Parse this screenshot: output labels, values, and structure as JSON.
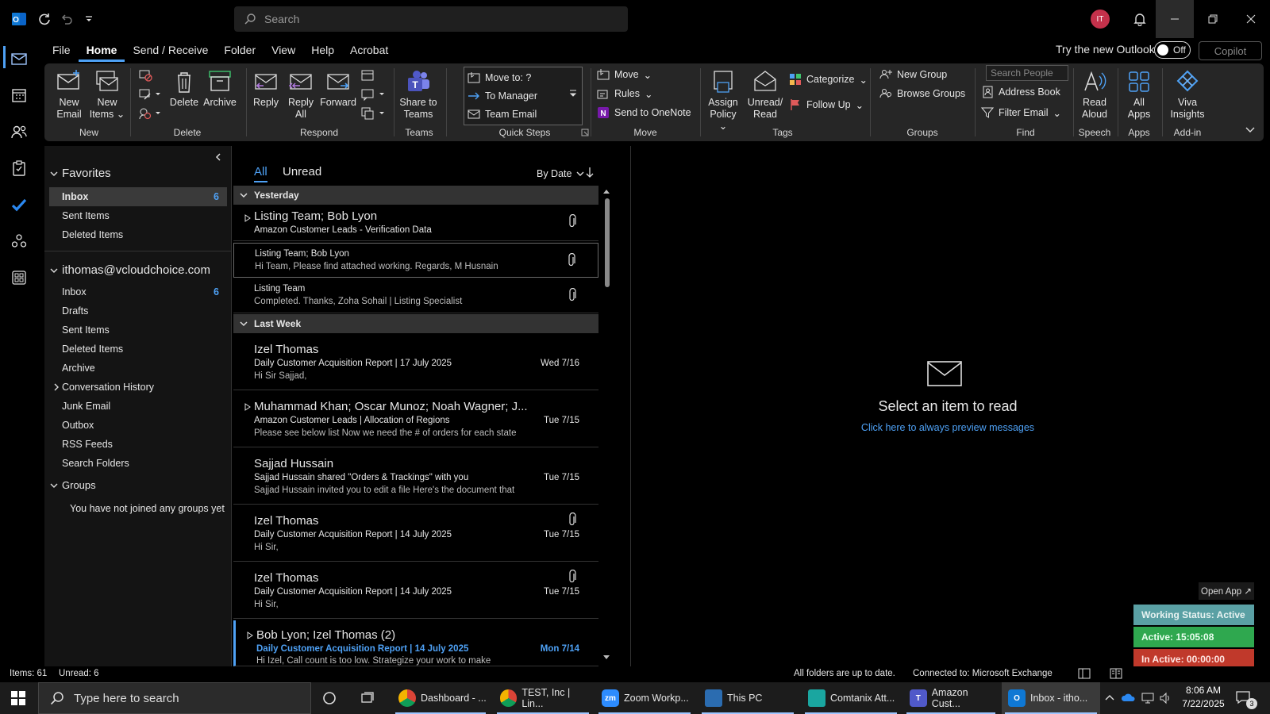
{
  "titlebar": {
    "search_placeholder": "Search",
    "avatar_initials": "IT"
  },
  "menu": {
    "tabs": [
      "File",
      "Home",
      "Send / Receive",
      "Folder",
      "View",
      "Help",
      "Acrobat"
    ],
    "active_tab": "Home",
    "try_new_label": "Try the new Outlook",
    "toggle_label": "Off",
    "copilot_label": "Copilot"
  },
  "ribbon": {
    "new_email": [
      "New",
      "Email"
    ],
    "new_items": [
      "New",
      "Items"
    ],
    "delete": "Delete",
    "archive": "Archive",
    "reply": "Reply",
    "reply_all": [
      "Reply",
      "All"
    ],
    "forward": "Forward",
    "share_teams": [
      "Share to",
      "Teams"
    ],
    "quick_steps": [
      "Move to: ?",
      "To Manager",
      "Team Email"
    ],
    "move": "Move",
    "rules": "Rules",
    "send_onenote": "Send to OneNote",
    "assign_policy": [
      "Assign",
      "Policy"
    ],
    "unread_read": [
      "Unread/",
      "Read"
    ],
    "categorize": "Categorize",
    "follow_up": "Follow Up",
    "new_group": "New Group",
    "browse_groups": "Browse Groups",
    "search_people_placeholder": "Search People",
    "address_book": "Address Book",
    "filter_email": "Filter Email",
    "read_aloud": [
      "Read",
      "Aloud"
    ],
    "all_apps": [
      "All",
      "Apps"
    ],
    "viva_insights": [
      "Viva",
      "Insights"
    ],
    "groups": [
      "New",
      "Delete",
      "Respond",
      "Teams",
      "Quick Steps",
      "Move",
      "Tags",
      "Groups",
      "Find",
      "Speech",
      "Apps",
      "Add-in"
    ]
  },
  "folders": {
    "favorites_label": "Favorites",
    "favorites": [
      {
        "label": "Inbox",
        "count": "6"
      },
      {
        "label": "Sent Items",
        "count": ""
      },
      {
        "label": "Deleted Items",
        "count": ""
      }
    ],
    "account_label": "ithomas@vcloudchoice.com",
    "account_items": [
      {
        "label": "Inbox",
        "count": "6"
      },
      {
        "label": "Drafts",
        "count": ""
      },
      {
        "label": "Sent Items",
        "count": ""
      },
      {
        "label": "Deleted Items",
        "count": ""
      },
      {
        "label": "Archive",
        "count": ""
      },
      {
        "label": "Conversation History",
        "count": ""
      },
      {
        "label": "Junk Email",
        "count": ""
      },
      {
        "label": "Outbox",
        "count": ""
      },
      {
        "label": "RSS Feeds",
        "count": ""
      },
      {
        "label": "Search Folders",
        "count": ""
      }
    ],
    "groups_label": "Groups",
    "groups_note": "You have not joined any groups yet"
  },
  "messages": {
    "tab_all": "All",
    "tab_unread": "Unread",
    "sort_label": "By Date",
    "group_yesterday": "Yesterday",
    "group_last_week": "Last Week",
    "items": [
      {
        "from": "Listing Team;  Bob Lyon",
        "subject": "Amazon Customer Leads -  Verification Data",
        "preview": "",
        "date": ""
      },
      {
        "from": "Listing Team;  Bob Lyon",
        "subject": "",
        "preview": "Hi Team,  Please find attached working.  Regards,  M Husnain",
        "date": ""
      },
      {
        "from": "Listing Team",
        "subject": "",
        "preview": "Completed.  Thanks,  Zoha Sohail | Listing Specialist",
        "date": ""
      },
      {
        "from": "Izel Thomas",
        "subject": "Daily Customer Acquisition Report | 17 July 2025",
        "preview": "Hi Sir Sajjad,",
        "date": "Wed 7/16"
      },
      {
        "from": "Muhammad Khan;  Oscar Munoz;  Noah Wagner;  J...",
        "subject": "Amazon Customer Leads | Allocation of Regions",
        "preview": "Please see below list  Now we need the # of orders for each state",
        "date": "Tue 7/15"
      },
      {
        "from": "Sajjad Hussain",
        "subject": "Sajjad Hussain shared \"Orders & Trackings\" with you",
        "preview": "Sajjad Hussain invited you to edit a file   Here's the document that",
        "date": "Tue 7/15"
      },
      {
        "from": "Izel Thomas",
        "subject": "Daily Customer Acquisition Report | 14 July 2025",
        "preview": "Hi Sir,",
        "date": "Tue 7/15"
      },
      {
        "from": "Izel Thomas",
        "subject": "Daily Customer Acquisition Report | 14 July 2025",
        "preview": "Hi Sir,",
        "date": "Tue 7/15"
      },
      {
        "from": "Bob Lyon;  Izel Thomas  (2)",
        "subject": "Daily Customer Acquisition Report | 14 July 2025",
        "preview": "Hi Izel,  Call count is too low. Strategize your work to make",
        "date": "Mon 7/14"
      }
    ]
  },
  "reading": {
    "title": "Select an item to read",
    "link": "Click here to always preview messages"
  },
  "widget": {
    "open_app": "Open App ↗",
    "working_status": "Working Status: Active",
    "active_time": "Active: 15:05:08",
    "inactive_time": "In Active: 00:00:00",
    "colors": {
      "status": "#5aa0a4",
      "active": "#2fa84f",
      "inactive": "#c0392b"
    }
  },
  "status": {
    "items": "Items: 61",
    "unread": "Unread: 6",
    "sync": "All folders are up to date.",
    "connection": "Connected to: Microsoft Exchange"
  },
  "taskbar": {
    "search_placeholder": "Type here to search",
    "apps": [
      "Dashboard - ...",
      "TEST, Inc | Lin...",
      "Zoom Workp...",
      "This PC",
      "Comtanix Att...",
      "Amazon Cust...",
      "Inbox - itho..."
    ],
    "time": "8:06 AM",
    "date": "7/22/2025",
    "notif_count": "3"
  },
  "accent_color": "#4ea1f5"
}
